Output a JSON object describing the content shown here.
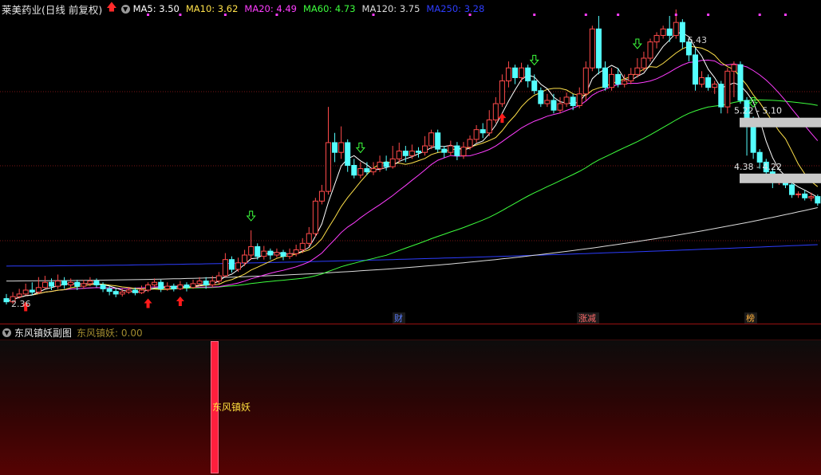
{
  "header": {
    "title": "莱美药业(日线 前复权)",
    "ma": [
      {
        "label": "MA5: 3.50",
        "color": "#ffffff"
      },
      {
        "label": "MA10: 3.62",
        "color": "#ffe14a"
      },
      {
        "label": "MA20: 4.49",
        "color": "#ff3dff"
      },
      {
        "label": "MA60: 4.73",
        "color": "#3dff3d"
      },
      {
        "label": "MA120: 3.75",
        "color": "#dcdcdc"
      },
      {
        "label": "MA250: 3.28",
        "color": "#2d3dff"
      }
    ]
  },
  "sub": {
    "title": "东风镇妖副图",
    "indicator": "东风镇妖: 0.00",
    "bar_label": "东风镇妖"
  },
  "chart_data": {
    "type": "candlestick",
    "y_range": [
      2.2,
      6.8
    ],
    "candles": [
      [
        2.45,
        2.4,
        2.52,
        2.36
      ],
      [
        2.4,
        2.48,
        2.55,
        2.37
      ],
      [
        2.48,
        2.52,
        2.6,
        2.45
      ],
      [
        2.52,
        2.58,
        2.68,
        2.5
      ],
      [
        2.58,
        2.55,
        2.7,
        2.5
      ],
      [
        2.55,
        2.62,
        2.78,
        2.52
      ],
      [
        2.62,
        2.7,
        2.8,
        2.6
      ],
      [
        2.7,
        2.64,
        2.76,
        2.58
      ],
      [
        2.64,
        2.72,
        2.82,
        2.6
      ],
      [
        2.72,
        2.66,
        2.78,
        2.6
      ],
      [
        2.66,
        2.7,
        2.76,
        2.62
      ],
      [
        2.7,
        2.64,
        2.74,
        2.58
      ],
      [
        2.64,
        2.68,
        2.74,
        2.6
      ],
      [
        2.68,
        2.72,
        2.78,
        2.64
      ],
      [
        2.72,
        2.66,
        2.76,
        2.62
      ],
      [
        2.66,
        2.6,
        2.7,
        2.55
      ],
      [
        2.6,
        2.56,
        2.64,
        2.5
      ],
      [
        2.56,
        2.52,
        2.6,
        2.47
      ],
      [
        2.52,
        2.55,
        2.6,
        2.48
      ],
      [
        2.55,
        2.58,
        2.63,
        2.52
      ],
      [
        2.58,
        2.54,
        2.62,
        2.5
      ],
      [
        2.54,
        2.58,
        2.65,
        2.52
      ],
      [
        2.58,
        2.66,
        2.7,
        2.55
      ],
      [
        2.66,
        2.7,
        2.76,
        2.62
      ],
      [
        2.7,
        2.6,
        2.74,
        2.55
      ],
      [
        2.6,
        2.64,
        2.7,
        2.57
      ],
      [
        2.64,
        2.6,
        2.68,
        2.56
      ],
      [
        2.6,
        2.66,
        2.72,
        2.58
      ],
      [
        2.66,
        2.62,
        2.7,
        2.56
      ],
      [
        2.62,
        2.68,
        2.74,
        2.6
      ],
      [
        2.68,
        2.72,
        2.78,
        2.65
      ],
      [
        2.72,
        2.66,
        2.78,
        2.6
      ],
      [
        2.66,
        2.72,
        2.8,
        2.62
      ],
      [
        2.72,
        2.8,
        2.86,
        2.68
      ],
      [
        2.8,
        3.05,
        3.15,
        2.78
      ],
      [
        3.05,
        2.9,
        3.1,
        2.85
      ],
      [
        2.9,
        3.0,
        3.08,
        2.86
      ],
      [
        3.0,
        3.12,
        3.2,
        2.95
      ],
      [
        3.12,
        3.25,
        3.5,
        3.05
      ],
      [
        3.25,
        3.1,
        3.3,
        3.05
      ],
      [
        3.1,
        3.18,
        3.26,
        3.05
      ],
      [
        3.18,
        3.12,
        3.22,
        3.05
      ],
      [
        3.12,
        3.16,
        3.22,
        3.08
      ],
      [
        3.16,
        3.1,
        3.2,
        3.04
      ],
      [
        3.1,
        3.14,
        3.22,
        3.06
      ],
      [
        3.14,
        3.2,
        3.28,
        3.1
      ],
      [
        3.2,
        3.3,
        3.38,
        3.15
      ],
      [
        3.3,
        3.45,
        3.55,
        3.25
      ],
      [
        3.45,
        3.95,
        4.0,
        3.4
      ],
      [
        3.95,
        4.1,
        4.2,
        3.9
      ],
      [
        4.1,
        4.85,
        5.4,
        4.05
      ],
      [
        4.85,
        4.7,
        5.0,
        4.55
      ],
      [
        4.7,
        4.85,
        5.1,
        4.6
      ],
      [
        4.85,
        4.5,
        4.9,
        4.4
      ],
      [
        4.5,
        4.35,
        4.6,
        4.3
      ],
      [
        4.35,
        4.45,
        4.55,
        4.3
      ],
      [
        4.45,
        4.4,
        4.55,
        4.35
      ],
      [
        4.4,
        4.45,
        4.55,
        4.35
      ],
      [
        4.45,
        4.55,
        4.65,
        4.4
      ],
      [
        4.55,
        4.48,
        4.65,
        4.42
      ],
      [
        4.48,
        4.6,
        4.8,
        4.45
      ],
      [
        4.6,
        4.72,
        4.85,
        4.55
      ],
      [
        4.72,
        4.65,
        4.8,
        4.55
      ],
      [
        4.65,
        4.72,
        4.82,
        4.6
      ],
      [
        4.72,
        4.7,
        4.78,
        4.62
      ],
      [
        4.7,
        4.8,
        4.95,
        4.65
      ],
      [
        4.8,
        5.0,
        5.05,
        4.75
      ],
      [
        5.0,
        4.75,
        5.05,
        4.7
      ],
      [
        4.75,
        4.7,
        4.8,
        4.62
      ],
      [
        4.7,
        4.8,
        4.88,
        4.65
      ],
      [
        4.8,
        4.65,
        4.86,
        4.58
      ],
      [
        4.65,
        4.78,
        4.86,
        4.6
      ],
      [
        4.78,
        4.9,
        4.96,
        4.74
      ],
      [
        4.9,
        5.05,
        5.12,
        4.85
      ],
      [
        5.05,
        5.0,
        5.15,
        4.92
      ],
      [
        5.0,
        5.2,
        5.35,
        4.95
      ],
      [
        5.2,
        5.45,
        5.55,
        5.15
      ],
      [
        5.45,
        5.8,
        5.9,
        5.4
      ],
      [
        5.8,
        6.0,
        6.1,
        5.7
      ],
      [
        6.0,
        5.85,
        6.05,
        5.75
      ],
      [
        5.85,
        6.0,
        6.08,
        5.78
      ],
      [
        6.0,
        5.8,
        6.05,
        5.7
      ],
      [
        5.8,
        5.65,
        5.9,
        5.6
      ],
      [
        5.65,
        5.45,
        5.7,
        5.4
      ],
      [
        5.45,
        5.5,
        5.6,
        5.4
      ],
      [
        5.5,
        5.35,
        5.6,
        5.3
      ],
      [
        5.35,
        5.45,
        5.55,
        5.3
      ],
      [
        5.45,
        5.55,
        5.62,
        5.4
      ],
      [
        5.55,
        5.42,
        5.6,
        5.35
      ],
      [
        5.42,
        5.6,
        5.7,
        5.38
      ],
      [
        5.6,
        6.0,
        6.1,
        5.5
      ],
      [
        6.0,
        6.6,
        6.65,
        5.95
      ],
      [
        6.6,
        6.0,
        6.8,
        5.9
      ],
      [
        6.0,
        5.7,
        6.1,
        5.65
      ],
      [
        5.7,
        5.9,
        6.0,
        5.65
      ],
      [
        5.9,
        5.75,
        6.0,
        5.7
      ],
      [
        5.75,
        5.8,
        5.9,
        5.7
      ],
      [
        5.8,
        5.9,
        6.0,
        5.75
      ],
      [
        5.9,
        6.0,
        6.15,
        5.85
      ],
      [
        6.0,
        6.15,
        6.25,
        5.95
      ],
      [
        6.15,
        6.4,
        6.45,
        6.1
      ],
      [
        6.4,
        6.5,
        6.55,
        6.3
      ],
      [
        6.5,
        6.6,
        6.65,
        6.45
      ],
      [
        6.6,
        6.5,
        6.8,
        6.4
      ],
      [
        6.5,
        6.7,
        6.9,
        6.45
      ],
      [
        6.7,
        6.4,
        6.75,
        6.3
      ],
      [
        6.4,
        6.2,
        6.45,
        6.1
      ],
      [
        6.2,
        5.75,
        6.3,
        5.65
      ],
      [
        5.75,
        5.85,
        5.95,
        5.7
      ],
      [
        5.85,
        5.7,
        5.9,
        5.65
      ],
      [
        5.7,
        5.75,
        5.8,
        5.6
      ],
      [
        5.75,
        5.4,
        5.8,
        5.3
      ],
      [
        5.4,
        5.95,
        6.0,
        5.3
      ],
      [
        5.95,
        6.05,
        6.1,
        5.55
      ],
      [
        6.05,
        5.5,
        6.1,
        5.45
      ],
      [
        5.5,
        5.2,
        5.55,
        4.65
      ],
      [
        5.2,
        4.7,
        5.25,
        4.6
      ],
      [
        4.7,
        4.55,
        4.75,
        4.45
      ],
      [
        4.55,
        4.4,
        4.6,
        4.3
      ],
      [
        4.4,
        4.25,
        4.45,
        4.15
      ],
      [
        4.25,
        4.28,
        4.35,
        4.2
      ],
      [
        4.28,
        4.2,
        4.32,
        4.15
      ],
      [
        4.2,
        4.05,
        4.25,
        4.0
      ],
      [
        4.05,
        4.06,
        4.1,
        4.0
      ],
      [
        4.06,
        4.0,
        4.12,
        3.96
      ],
      [
        4.0,
        4.02,
        4.08,
        3.95
      ],
      [
        4.02,
        3.92,
        4.05,
        3.88
      ]
    ],
    "markers": [
      {
        "i": 3,
        "type": "up"
      },
      {
        "i": 22,
        "type": "up"
      },
      {
        "i": 27,
        "type": "up"
      },
      {
        "i": 38,
        "type": "down"
      },
      {
        "i": 55,
        "type": "down"
      },
      {
        "i": 77,
        "type": "up"
      },
      {
        "i": 82,
        "type": "down"
      },
      {
        "i": 98,
        "type": "down"
      },
      {
        "i": 116,
        "type": "down"
      }
    ],
    "annotations": [
      {
        "label": "2.36",
        "i": 0,
        "price": 2.36
      },
      {
        "label": "6.43",
        "i": 107,
        "price": 6.43
      },
      {
        "label": "5.22 - 5.10",
        "price": 5.16
      },
      {
        "label": "4.38 - 4.22",
        "price": 4.3
      }
    ],
    "events": [
      "财",
      "涨减",
      "榜"
    ],
    "sub_value": 0.0
  }
}
